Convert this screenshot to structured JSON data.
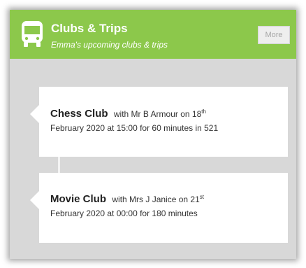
{
  "header": {
    "title": "Clubs & Trips",
    "subtitle": "Emma's upcoming clubs & trips",
    "icon": "bus-icon",
    "more_label": "More",
    "color": "#8cc84b"
  },
  "clubs": [
    {
      "name": "Chess Club",
      "detail_prefix": "with Mr B Armour on 18",
      "detail_suffix": "th",
      "detail_line2": "February 2020 at 15:00 for 60 minutes in 521"
    },
    {
      "name": "Movie Club",
      "detail_prefix": "with Mrs J Janice on 21",
      "detail_suffix": "st",
      "detail_line2": "February 2020 at 00:00 for 180 minutes"
    }
  ]
}
